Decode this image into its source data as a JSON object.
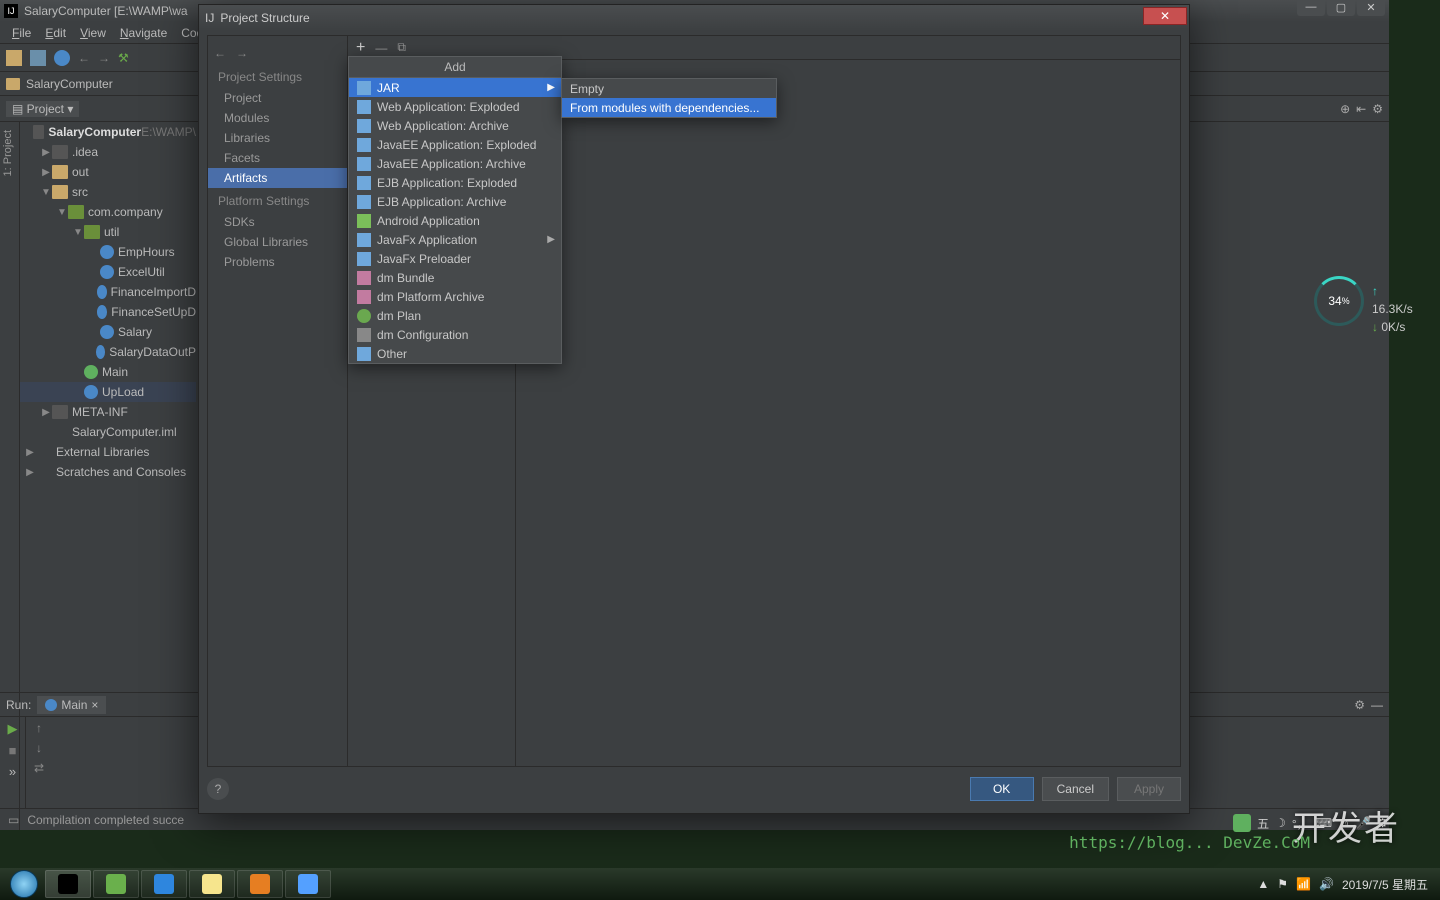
{
  "ide": {
    "title": "SalaryComputer [E:\\WAMP\\wa",
    "menus": [
      "File",
      "Edit",
      "View",
      "Navigate",
      "Cod"
    ],
    "menu_underline": [
      0,
      0,
      0,
      0,
      -1
    ],
    "breadcrumb": "SalaryComputer",
    "project_dropdown": "Project",
    "side_labels": [
      "1: Project"
    ],
    "tree": [
      {
        "d": 0,
        "t": "SalaryComputer",
        "suffix": "  E:\\WAMP\\",
        "ic": "fold",
        "bold": true,
        "open": true
      },
      {
        "d": 1,
        "t": ".idea",
        "ic": "fold",
        "arrow": "▶"
      },
      {
        "d": 1,
        "t": "out",
        "ic": "fold o",
        "arrow": "▶"
      },
      {
        "d": 1,
        "t": "src",
        "ic": "fold o",
        "arrow": "▼",
        "open": true
      },
      {
        "d": 2,
        "t": "com.company",
        "ic": "pkg",
        "arrow": "▼",
        "open": true
      },
      {
        "d": 3,
        "t": "util",
        "ic": "pkg",
        "arrow": "▼",
        "open": true
      },
      {
        "d": 4,
        "t": "EmpHours",
        "ic": "cls"
      },
      {
        "d": 4,
        "t": "ExcelUtil",
        "ic": "cls"
      },
      {
        "d": 4,
        "t": "FinanceImportD",
        "ic": "cls"
      },
      {
        "d": 4,
        "t": "FinanceSetUpD",
        "ic": "cls"
      },
      {
        "d": 4,
        "t": "Salary",
        "ic": "cls"
      },
      {
        "d": 4,
        "t": "SalaryDataOutP",
        "ic": "cls"
      },
      {
        "d": 3,
        "t": "Main",
        "ic": "cls2"
      },
      {
        "d": 3,
        "t": "UpLoad",
        "ic": "cls",
        "sel": true
      },
      {
        "d": 1,
        "t": "META-INF",
        "ic": "fold",
        "arrow": "▶"
      },
      {
        "d": 1,
        "t": "SalaryComputer.iml",
        "ic": "cfg"
      },
      {
        "d": 0,
        "t": "External Libraries",
        "ic": "lib",
        "arrow": "▶"
      },
      {
        "d": 0,
        "t": "Scratches and Consoles",
        "ic": "scratch",
        "arrow": "▶"
      }
    ],
    "run_label": "Run:",
    "run_tab": "Main",
    "status": "Compilation completed succe"
  },
  "dialog": {
    "title": "Project Structure",
    "nav_back": "←",
    "nav_fwd": "→",
    "sections": {
      "Project Settings": [
        "Project",
        "Modules",
        "Libraries",
        "Facets",
        "Artifacts"
      ],
      "Platform Settings": [
        "SDKs",
        "Global Libraries"
      ],
      "": [
        "Problems"
      ]
    },
    "selected_nav": "Artifacts",
    "toolbar_plus": "+",
    "toolbar_minus": "—",
    "popup1_title": "Add",
    "popup1_items": [
      {
        "t": "JAR",
        "sel": true,
        "sub": true,
        "ic": "jar"
      },
      {
        "t": "Web Application: Exploded",
        "ic": "web"
      },
      {
        "t": "Web Application: Archive",
        "ic": "web"
      },
      {
        "t": "JavaEE Application: Exploded",
        "ic": "jee"
      },
      {
        "t": "JavaEE Application: Archive",
        "ic": "jee"
      },
      {
        "t": "EJB Application: Exploded",
        "ic": "jee"
      },
      {
        "t": "EJB Application: Archive",
        "ic": "jee"
      },
      {
        "t": "Android Application",
        "ic": "and"
      },
      {
        "t": "JavaFx Application",
        "sub": true,
        "ic": "fx"
      },
      {
        "t": "JavaFx Preloader",
        "ic": "fx"
      },
      {
        "t": "dm Bundle",
        "ic": "dm"
      },
      {
        "t": "dm Platform Archive",
        "ic": "dm"
      },
      {
        "t": "dm Plan",
        "ic": "plan"
      },
      {
        "t": "dm Configuration",
        "ic": "cfg"
      },
      {
        "t": "Other",
        "ic": "other"
      }
    ],
    "popup2_items": [
      {
        "t": "Empty"
      },
      {
        "t": "From modules with dependencies...",
        "sel": true
      }
    ],
    "buttons": {
      "ok": "OK",
      "cancel": "Cancel",
      "apply": "Apply",
      "help": "?"
    }
  },
  "overlay": {
    "perf_pct": "34",
    "perf_unit": "%",
    "net_up": "16.3K/s",
    "net_down": "0K/s",
    "watermark": "开发者",
    "watermark_site": "https://blog... DevZe.CoM",
    "ime": "五",
    "clock_line1": "2019/7/5 星期五"
  },
  "taskbar": {
    "items": [
      "IJ",
      "leaf",
      "rocket",
      "explorer",
      "firefox",
      "edge"
    ],
    "active": 0
  }
}
